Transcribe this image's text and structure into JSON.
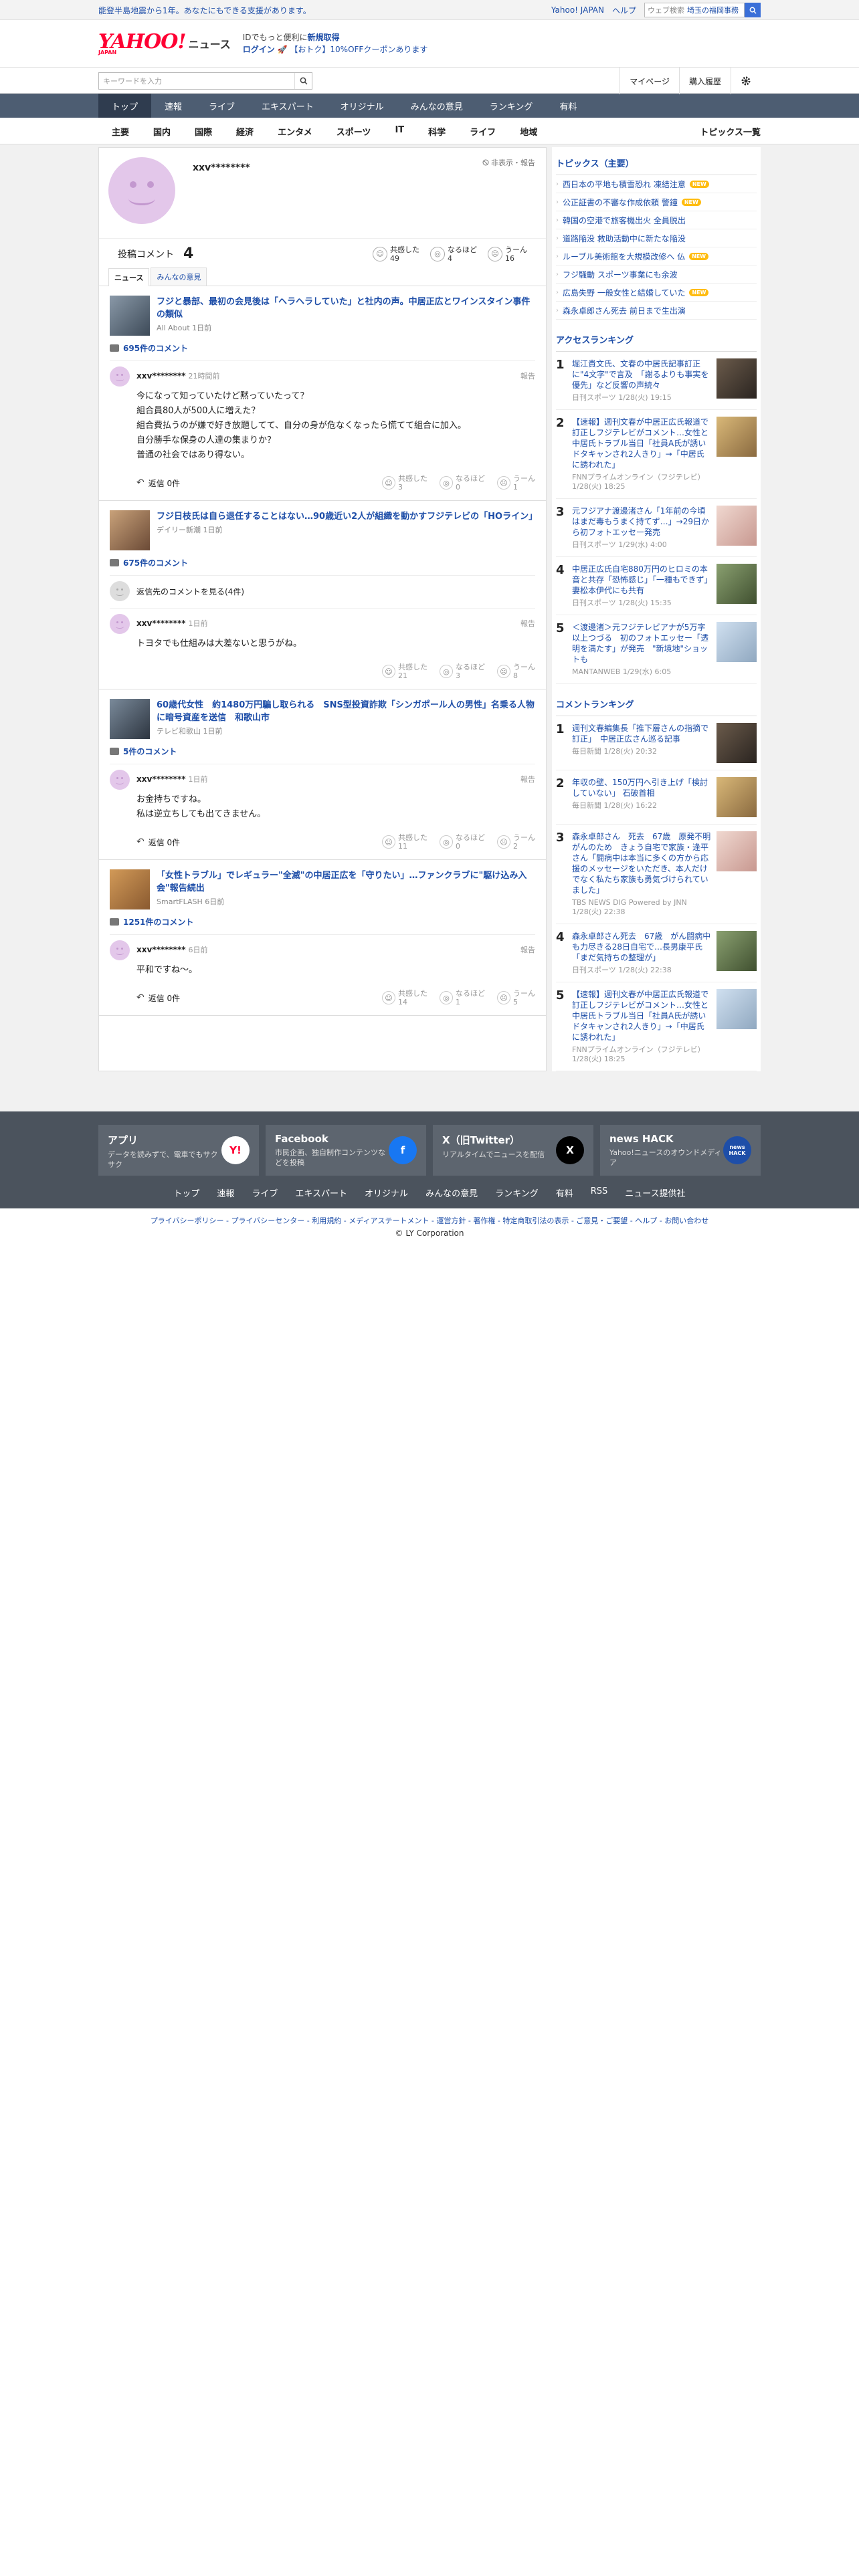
{
  "topbar": {
    "promo": "能登半島地震から1年。あなたにもできる支援があります。",
    "links": [
      "Yahoo! JAPAN",
      "ヘルプ"
    ],
    "weather_placeholder": "ウェブ検索",
    "weather_location": "埼玉の福岡事務"
  },
  "header": {
    "logo_text": "YAHOO!",
    "logo_sub": "JAPAN",
    "logo_section": "ニュース",
    "promo_l1_pre": "IDでもっと便利に",
    "promo_l1_link": "新規取得",
    "promo_l2_link": "ログイン",
    "promo_l2_text": "【おトク】10%OFFクーポンあります"
  },
  "subhead": {
    "search_placeholder": "キーワードを入力",
    "mypage": "マイページ",
    "history": "購入履歴"
  },
  "nav1": [
    "トップ",
    "速報",
    "ライブ",
    "エキスパート",
    "オリジナル",
    "みんなの意見",
    "ランキング",
    "有料"
  ],
  "nav2": [
    "主要",
    "国内",
    "国際",
    "経済",
    "エンタメ",
    "スポーツ",
    "IT",
    "科学",
    "ライフ",
    "地域"
  ],
  "nav2_topics": "トピックス一覧",
  "profile": {
    "username": "xxv********",
    "report": "非表示・報告",
    "posts_label": "投稿コメント",
    "posts_count": "4",
    "reacts": [
      {
        "label": "共感した",
        "count": "49"
      },
      {
        "label": "なるほど",
        "count": "4"
      },
      {
        "label": "うーん",
        "count": "16"
      }
    ]
  },
  "tabs": [
    "ニュース",
    "みんなの意見"
  ],
  "articles": [
    {
      "title": "フジと暴部、最初の会見後は「ヘラヘラしていた」と社内の声。中居正広とワインスタイン事件の類似",
      "source": "All About 1日前",
      "comment_count": "695件のコメント",
      "comment": {
        "user": "xxv********",
        "time": "21時間前",
        "report": "報告",
        "text": [
          "今になって知っていたけど黙っていたって？",
          "組合員80人が500人に増えた？",
          "組合費払うのが嫌で好き放題してて、自分の身が危なくなったら慌てて組合に加入。",
          "自分勝手な保身の人達の集まりか？",
          "普通の社会ではあり得ない。"
        ],
        "reply": "返信 0件",
        "reacts": [
          {
            "label": "共感した",
            "count": "3"
          },
          {
            "label": "なるほど",
            "count": "0"
          },
          {
            "label": "うーん",
            "count": "1"
          }
        ]
      }
    },
    {
      "title": "フジ日枝氏は自ら退任することはない…90歳近い2人が組織を動かすフジテレビの「HOライン」",
      "source": "デイリー新潮 1日前",
      "comment_count": "675件のコメント",
      "expand": "返信先のコメントを見る(4件)",
      "comment": {
        "user": "xxv********",
        "time": "1日前",
        "report": "報告",
        "text": [
          "トヨタでも仕組みは大差ないと思うがね。"
        ],
        "reply": "",
        "reacts": [
          {
            "label": "共感した",
            "count": "21"
          },
          {
            "label": "なるほど",
            "count": "3"
          },
          {
            "label": "うーん",
            "count": "8"
          }
        ]
      }
    },
    {
      "title": "60歳代女性　約1480万円騙し取られる　SNS型投資詐欺「シンガポール人の男性」名乗る人物に暗号資産を送信　和歌山市",
      "source": "テレビ和歌山 1日前",
      "comment_count": "5件のコメント",
      "comment": {
        "user": "xxv********",
        "time": "1日前",
        "report": "報告",
        "text": [
          "お金持ちですね。",
          "私は逆立ちしても出てきません。"
        ],
        "reply": "返信 0件",
        "reacts": [
          {
            "label": "共感した",
            "count": "11"
          },
          {
            "label": "なるほど",
            "count": "0"
          },
          {
            "label": "うーん",
            "count": "2"
          }
        ]
      }
    },
    {
      "title": "「女性トラブル」でレギュラー\"全滅\"の中居正広を「守りたい」…ファンクラブに\"駆け込み入会\"報告続出",
      "source": "SmartFLASH 6日前",
      "comment_count": "1251件のコメント",
      "comment": {
        "user": "xxv********",
        "time": "6日前",
        "report": "報告",
        "text": [
          "平和ですね〜。"
        ],
        "reply": "返信 0件",
        "reacts": [
          {
            "label": "共感した",
            "count": "14"
          },
          {
            "label": "なるほど",
            "count": "1"
          },
          {
            "label": "うーん",
            "count": "5"
          }
        ]
      }
    }
  ],
  "side": {
    "topics_title": "トピックス（主要）",
    "topics": [
      {
        "text": "西日本の平地も積雪恐れ 凍結注意",
        "new": true,
        "badge": "NEW"
      },
      {
        "text": "公正証書の不審な作成依頼 警鐘",
        "new": true,
        "badge": "NEW"
      },
      {
        "text": "韓国の空港で旅客機出火 全員脱出",
        "new": false
      },
      {
        "text": "道路陥没 救助活動中に新たな陥没",
        "new": false
      },
      {
        "text": "ルーブル美術館を大規模改修へ 仏",
        "new": true,
        "badge": "NEW"
      },
      {
        "text": "フジ騒動 スポーツ事業にも余波",
        "new": false
      },
      {
        "text": "広島失野 一般女性と結婚していた",
        "new": true,
        "badge": "NEW"
      },
      {
        "text": "森永卓郎さん死去 前日まで生出演",
        "new": false
      }
    ],
    "access_title": "アクセスランキング",
    "access": [
      {
        "n": "1",
        "title": "堀江貴文氏、文春の中居氏記事訂正に\"4文字\"で言及　「謝るよりも事実を優先」など反響の声続々",
        "src": "日刊スポーツ 1/28(火) 19:15"
      },
      {
        "n": "2",
        "title": "【速報】週刊文春が中居正広氏報道で訂正しフジテレビがコメント…女性と中居氏トラブル当日「社員A氏が誘いドタキャンされ2人きり」→「中居氏に誘われた」",
        "src": "FNNプライムオンライン（フジテレビ） 1/28(火) 18:25"
      },
      {
        "n": "3",
        "title": "元フジアナ渡邊渚さん「1年前の今頃はまだ毒もうまく持てず…」→29日から初フォトエッセー発売",
        "src": "日刊スポーツ 1/29(水) 4:00"
      },
      {
        "n": "4",
        "title": "中居正広氏自宅880万円のヒロミの本音と共存「恐怖感じ」「一種もできず」妻松本伊代にも共有",
        "src": "日刊スポーツ 1/28(火) 15:35"
      },
      {
        "n": "5",
        "title": "＜渡邊渚＞元フジテレビアナが5万字以上つづる　初のフォトエッセー「透明を満たす」が発売　\"新境地\"ショットも",
        "src": "MANTANWEB 1/29(水) 6:05"
      }
    ],
    "comment_title": "コメントランキング",
    "comments": [
      {
        "n": "1",
        "title": "週刊文春編集長「推下層さんの指摘で訂正」　中居正広さん巡る記事",
        "src": "毎日新聞 1/28(火) 20:32"
      },
      {
        "n": "2",
        "title": "年収の壁、150万円へ引き上げ「検討していない」 石破首相",
        "src": "毎日新聞 1/28(火) 16:22"
      },
      {
        "n": "3",
        "title": "森永卓郎さん　死去　67歳　原発不明がんのため　きょう自宅で家族・逢平さん「闘病中は本当に多くの方から応援のメッセージをいただき、本人だけでなく私たち家族も勇気づけられていました」",
        "src": "TBS NEWS DIG Powered by JNN 1/28(火) 22:38"
      },
      {
        "n": "4",
        "title": "森永卓郎さん死去　67歳　がん闘病中も力尽きる28日自宅で…長男康平氏「まだ気持ちの整理が」",
        "src": "日刊スポーツ 1/28(火) 22:38"
      },
      {
        "n": "5",
        "title": "【速報】週刊文春が中居正広氏報道で訂正しフジテレビがコメント…女性と中居氏トラブル当日「社員A氏が誘いドタキャンされ2人きり」→「中居氏に誘われた」",
        "src": "FNNプライムオンライン（フジテレビ） 1/28(火) 18:25"
      }
    ]
  },
  "footer": {
    "cards": [
      {
        "title": "アプリ",
        "desc": "データを読みずで、電車でもサクサク",
        "icon": "Y!"
      },
      {
        "title": "Facebook",
        "desc": "市民企画、独自制作コンテンツなどを投稿",
        "icon": "f"
      },
      {
        "title": "X（旧Twitter）",
        "desc": "リアルタイムでニュースを配信",
        "icon": "X"
      },
      {
        "title": "news HACK",
        "desc": "Yahoo!ニュースのオウンドメディア",
        "icon": "news HACK"
      }
    ],
    "links": [
      "トップ",
      "速報",
      "ライブ",
      "エキスパート",
      "オリジナル",
      "みんなの意見",
      "ランキング",
      "有料",
      "RSS",
      "ニュース提供社"
    ],
    "legal": "プライバシーポリシー - プライバシーセンター - 利用規約 - メディアステートメント - 運営方針 - 著作権 - 特定商取引法の表示 - ご意見・ご要望 - ヘルプ - お問い合わせ",
    "copyright": "© LY Corporation"
  },
  "colors": {
    "brand": "#ff0033",
    "link": "#1e4ea8",
    "nav": "#4d5d72",
    "avatar": "#e3c7ea"
  }
}
